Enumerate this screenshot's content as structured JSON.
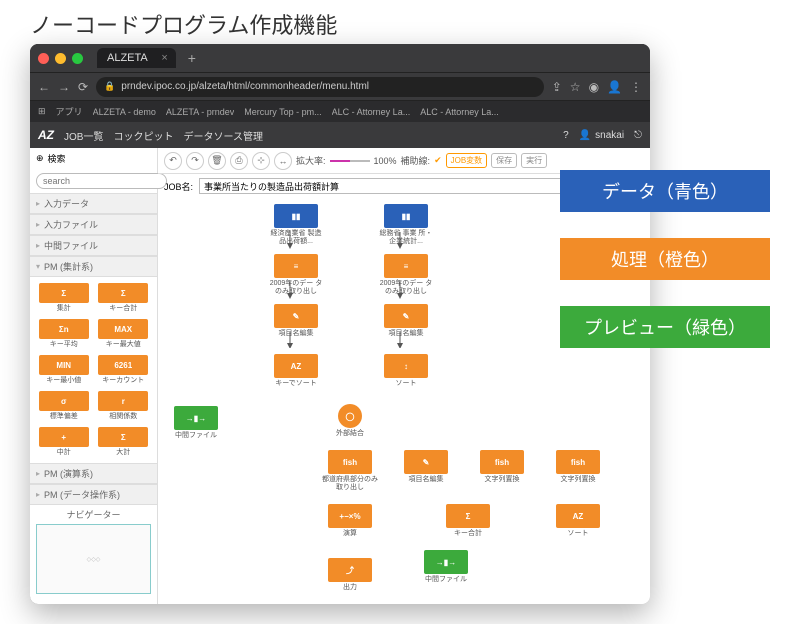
{
  "page_title": "ノーコードプログラム作成機能",
  "browser": {
    "tab_title": "ALZETA",
    "url": "prndev.ipoc.co.jp/alzeta/html/commonheader/menu.html",
    "bookmarks_label": "アプリ",
    "bookmarks": [
      "ALZETA - demo",
      "ALZETA - prndev",
      "Mercury Top - pm...",
      "ALC - Attorney La...",
      "ALC - Attorney La..."
    ]
  },
  "app": {
    "logo": "AZ",
    "menus": [
      "JOB一覧",
      "コックピット",
      "データソース管理"
    ],
    "user": "snakai",
    "search_label": "検索",
    "search_placeholder": "search",
    "sidebar_sections": {
      "s0": "入力データ",
      "s1": "入力ファイル",
      "s2": "中間ファイル",
      "s3": "PM (集計系)",
      "s4": "PM (演算系)",
      "s5": "PM (データ操作系)"
    },
    "pm_items": [
      {
        "glyph": "Σ",
        "label": "集計"
      },
      {
        "glyph": "Σ",
        "label": "キー合計"
      },
      {
        "glyph": "Σn",
        "label": "キー平均"
      },
      {
        "glyph": "MAX",
        "label": "キー最大値"
      },
      {
        "glyph": "MIN",
        "label": "キー最小値"
      },
      {
        "glyph": "6261",
        "label": "キーカウント"
      },
      {
        "glyph": "σ",
        "label": "標準偏差"
      },
      {
        "glyph": "r",
        "label": "相関係数"
      },
      {
        "glyph": "+",
        "label": "中計"
      },
      {
        "glyph": "Σ",
        "label": "大計"
      }
    ],
    "navigator_label": "ナビゲーター",
    "toolbar": {
      "zoom_label": "拡大率:",
      "zoom_value": "100%",
      "aux_label": "補助線:",
      "job_var": "JOB変数",
      "save": "保存",
      "run": "実行",
      "jobname_label": "JOB名:",
      "jobname_value": "事業所当たりの製造品出荷額計算"
    },
    "nodes": {
      "d1": "経済産業省\n製造品出荷額...",
      "d2": "総務省 事業\n所・企業統計...",
      "p1": "2009年のデー\nタのみ取り出し",
      "p2": "2009年のデー\nタのみ取り出し",
      "p3": "項目名編集",
      "p4": "項目名編集",
      "p5": "キーでソート",
      "p6": "ソート",
      "g1": "中間ファイル",
      "p7": "外部結合",
      "p8": "都道府県部分のみ\n取り出し",
      "p9": "項目名編集",
      "p10": "文字列置換",
      "p11": "文字列置換",
      "p12": "演算",
      "p13": "キー合計",
      "p14": "ソート",
      "p15": "出力",
      "g2": "中間ファイル"
    }
  },
  "legend": {
    "data": "データ（青色）",
    "proc": "処理（橙色）",
    "prev": "プレビュー（緑色）"
  }
}
